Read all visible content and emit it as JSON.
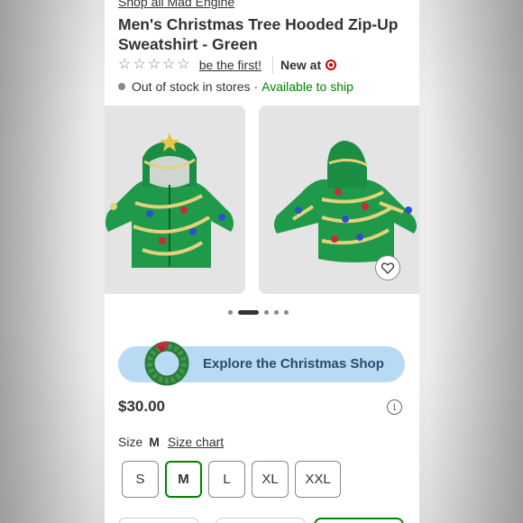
{
  "breadcrumb": "Shop all Mad Engine",
  "product": {
    "title": "Men's Christmas Tree Hooded Zip-Up Sweatshirt - Green",
    "rating_link": "be the first!",
    "new_at": "New at",
    "stock_status": "Out of stock in stores",
    "stock_separator": "·",
    "ship_status": "Available to ship",
    "price": "$30.00"
  },
  "gallery": {
    "image_count": 5,
    "active_index": 1,
    "favorite_icon": "heart-icon"
  },
  "promo": {
    "label": "Explore the Christmas Shop"
  },
  "size": {
    "label": "Size",
    "selected": "M",
    "chart_link": "Size chart",
    "options": [
      "S",
      "M",
      "L",
      "XL",
      "XXL"
    ]
  },
  "colors": {
    "accent_green": "#008300",
    "promo_bg": "#b8daf2",
    "promo_text": "#254c6e",
    "target_red": "#cc0000",
    "sweatshirt_green": "#1f9a4a"
  }
}
